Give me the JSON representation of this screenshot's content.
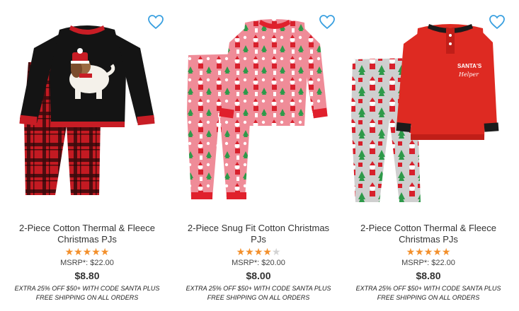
{
  "products": [
    {
      "title_line1": "2-Piece Cotton Thermal & Fleece",
      "title_line2": "Christmas PJs",
      "rating": 5,
      "msrp": "MSRP*: $22.00",
      "price": "$8.80",
      "promo_line1": "EXTRA 25% OFF $50+ WITH CODE SANTA PLUS",
      "promo_line2": "FREE SHIPPING ON ALL ORDERS",
      "image_icon": "pajama-image-dog-plaid",
      "colors": {
        "top": "#141414",
        "pants": "#c41a22",
        "cuff": "#c81d25"
      }
    },
    {
      "title_line1": "2-Piece Snug Fit Cotton Christmas",
      "title_line2": "PJs",
      "rating": 4,
      "msrp": "MSRP*: $20.00",
      "price": "$8.00",
      "promo_line1": "EXTRA 25% OFF $50+ WITH CODE SANTA PLUS",
      "promo_line2": "FREE SHIPPING ON ALL ORDERS",
      "image_icon": "pajama-image-santa-pink",
      "colors": {
        "top": "#ef8c98",
        "pants": "#ef8c98",
        "cuff": "#e0202c"
      }
    },
    {
      "title_line1": "2-Piece Cotton Thermal & Fleece",
      "title_line2": "Christmas PJs",
      "rating": 5,
      "msrp": "MSRP*: $22.00",
      "price": "$8.80",
      "promo_line1": "EXTRA 25% OFF $50+ WITH CODE SANTA PLUS",
      "promo_line2": "FREE SHIPPING ON ALL ORDERS",
      "image_icon": "pajama-image-santas-helper",
      "top_print": "SANTA'S",
      "top_print_script": "Helper",
      "colors": {
        "top": "#de2a22",
        "pants": "#cfcfcf",
        "cuff": "#1b1b1b"
      }
    }
  ],
  "colors": {
    "star": "#f3902c",
    "star_off": "#d3d3d3",
    "heart": "#3aa0e0"
  },
  "icons": {
    "wishlist": "heart-outline-icon",
    "star": "star-icon"
  }
}
